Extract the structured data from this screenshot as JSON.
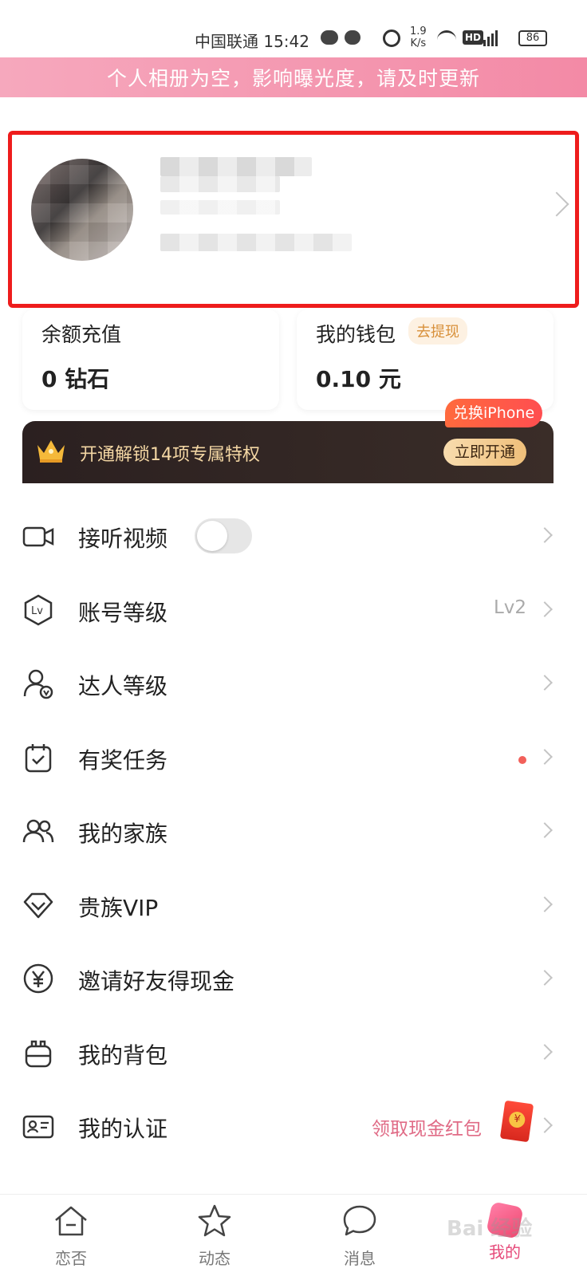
{
  "status_bar": {
    "carrier_time": "中国联通 15:42",
    "net_speed_value": "1.9",
    "net_speed_unit": "K/s",
    "hd": "HD",
    "battery": "86"
  },
  "banner": {
    "text": "个人相册为空，影响曝光度，请及时更新"
  },
  "balance": {
    "recharge_title": "余额充值",
    "recharge_value": "0 钻石",
    "wallet_title": "我的钱包",
    "wallet_withdraw": "去提现",
    "wallet_value": "0.10 元"
  },
  "vip": {
    "text": "开通解锁14项专属特权",
    "button": "立即开通",
    "badge": "兑换iPhone"
  },
  "menu": {
    "items": [
      {
        "label": "接听视频",
        "icon": "video-camera-icon"
      },
      {
        "label": "账号等级",
        "icon": "level-badge-icon",
        "value": "Lv2"
      },
      {
        "label": "达人等级",
        "icon": "user-verified-icon"
      },
      {
        "label": "有奖任务",
        "icon": "calendar-check-icon"
      },
      {
        "label": "我的家族",
        "icon": "group-users-icon"
      },
      {
        "label": "贵族VIP",
        "icon": "diamond-icon"
      },
      {
        "label": "邀请好友得现金",
        "icon": "yen-coin-icon"
      },
      {
        "label": "我的背包",
        "icon": "backpack-icon"
      },
      {
        "label": "我的认证",
        "icon": "id-card-icon",
        "value": "领取现金红包"
      }
    ]
  },
  "bottom_nav": {
    "tabs": [
      {
        "label": "恋否",
        "icon": "home-icon"
      },
      {
        "label": "动态",
        "icon": "star-icon"
      },
      {
        "label": "消息",
        "icon": "chat-bubble-icon"
      },
      {
        "label": "我的",
        "icon": "profile-tab-icon",
        "active": true
      }
    ]
  },
  "watermark": "Bai 经验",
  "colors": {
    "banner_pink": "#f38aa6",
    "highlight_red": "#ee1c1c",
    "vip_dark": "#2b2020",
    "vip_gold": "#efbf7a",
    "active_pink": "#e64a7a"
  }
}
